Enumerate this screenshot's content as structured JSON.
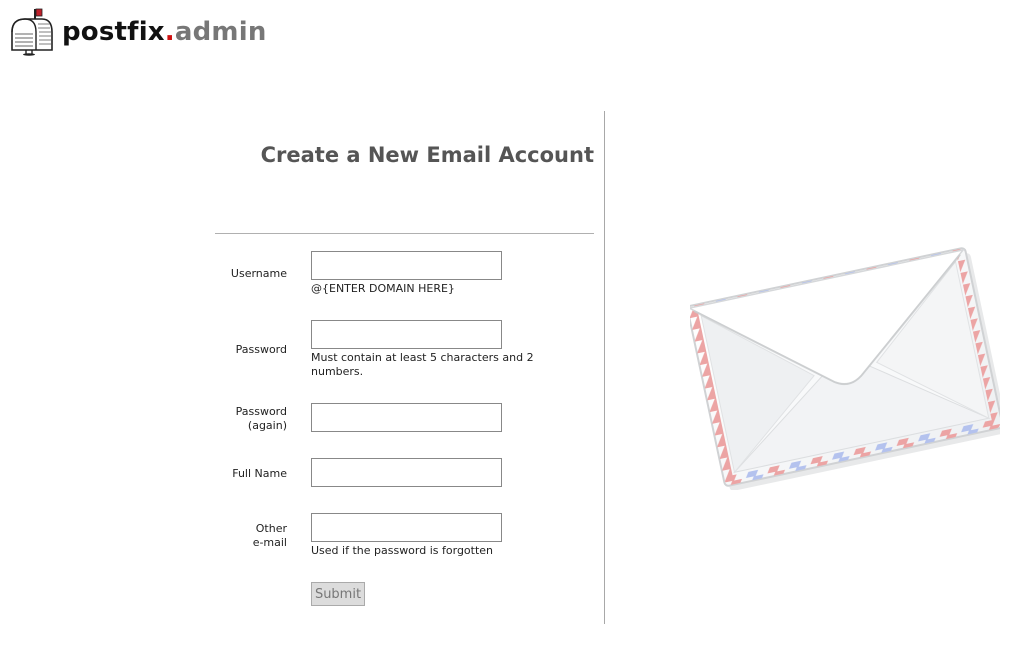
{
  "header": {
    "logo_icon": "mailbox-icon",
    "logo_part1": "postfix",
    "logo_dot": ".",
    "logo_part2": "admin"
  },
  "form": {
    "title": "Create a New Email Account",
    "fields": {
      "username": {
        "label": "Username",
        "value": "",
        "hint": "@{ENTER DOMAIN HERE}"
      },
      "password": {
        "label": "Password",
        "value": "",
        "hint_line1": "Must contain at least 5 characters and 2",
        "hint_line2": "numbers."
      },
      "password_again": {
        "label_line1": "Password",
        "label_line2": "(again)",
        "value": ""
      },
      "full_name": {
        "label": "Full Name",
        "value": ""
      },
      "other_email": {
        "label_line1": "Other",
        "label_line2": "e-mail",
        "value": "",
        "hint": "Used if the password is forgotten"
      }
    },
    "submit_label": "Submit"
  },
  "illustration": {
    "icon": "airmail-envelope-icon"
  },
  "colors": {
    "logo_dark": "#111111",
    "logo_dot": "#d01010",
    "logo_grey": "#777777",
    "title": "#555555",
    "airmail_red": "#e8a0a0",
    "airmail_blue": "#a8b8e8"
  }
}
